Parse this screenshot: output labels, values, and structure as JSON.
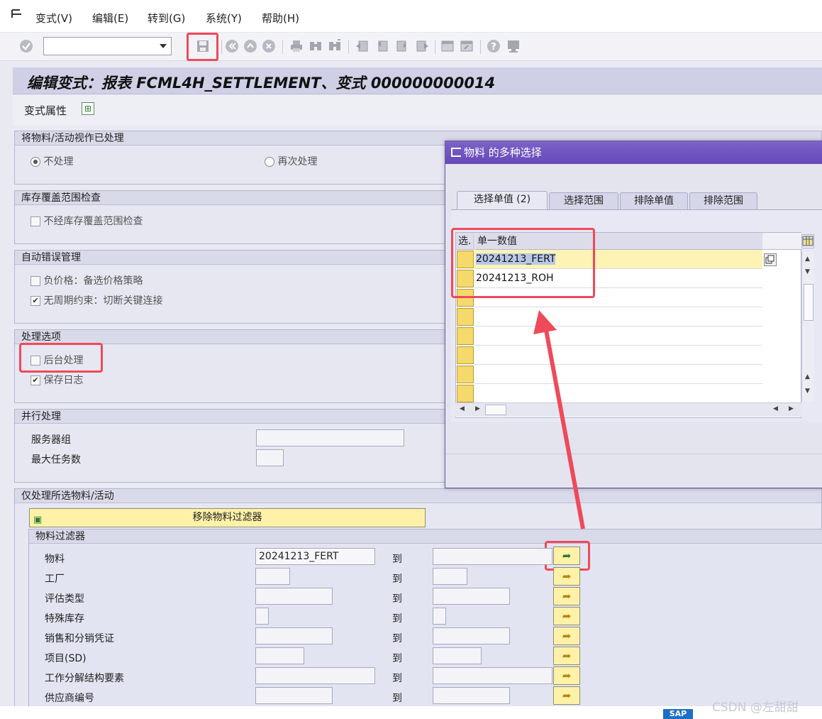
{
  "menu": {
    "items": [
      "变式(V)",
      "编辑(E)",
      "转到(G)",
      "系统(Y)",
      "帮助(H)"
    ]
  },
  "toolbar": {
    "command_value": "",
    "icons": [
      "enter-icon",
      "save-icon",
      "back-icon",
      "exit-icon",
      "cancel-icon",
      "print-icon",
      "find-icon",
      "find-next-icon",
      "first-page-icon",
      "prev-page-icon",
      "next-page-icon",
      "last-page-icon",
      "new-session-icon",
      "shortcut-icon",
      "help-icon",
      "customize-icon"
    ]
  },
  "page": {
    "title": "编辑变式：报表 FCML4H_SETTLEMENT、变式 000000000014",
    "app_button": "变式属性"
  },
  "groups": {
    "g1": {
      "title": "将物料/活动视作已处理",
      "opt1": "不处理",
      "opt2": "再次处理",
      "selected": "不处理"
    },
    "g2": {
      "title": "库存覆盖范围检查",
      "chk1": "不经库存覆盖范围检查",
      "chk1_checked": false
    },
    "g3": {
      "title": "自动错误管理",
      "chk1": "负价格：备选价格策略",
      "chk1_checked": false,
      "chk2": "无周期约束：切断关键连接",
      "chk2_checked": true
    },
    "g4": {
      "title": "处理选项",
      "chk1": "后台处理",
      "chk1_checked": false,
      "chk2": "保存日志",
      "chk2_checked": true
    },
    "g5": {
      "title": "并行处理",
      "l1": "服务器组",
      "l2": "最大任务数"
    },
    "g6": {
      "title": "仅处理所选物料/活动",
      "remove_btn": "移除物料过滤器",
      "sub_title": "物料过滤器",
      "to": "到",
      "rows": [
        {
          "label": "物料",
          "from": "20241213_FERT",
          "to_val": ""
        },
        {
          "label": "工厂",
          "from": "",
          "to_val": ""
        },
        {
          "label": "评估类型",
          "from": "",
          "to_val": ""
        },
        {
          "label": "特殊库存",
          "from": "",
          "to_val": ""
        },
        {
          "label": "销售和分销凭证",
          "from": "",
          "to_val": ""
        },
        {
          "label": "项目(SD)",
          "from": "",
          "to_val": ""
        },
        {
          "label": "工作分解结构要素",
          "from": "",
          "to_val": ""
        },
        {
          "label": "供应商编号",
          "from": "",
          "to_val": ""
        }
      ]
    }
  },
  "dialog": {
    "title": "物料 的多种选择",
    "tabs": [
      "选择单值 (2)",
      "选择范围",
      "排除单值",
      "排除范围"
    ],
    "active_tab": "选择单值 (2)",
    "col_sel": "选.",
    "col_value": "单一数值",
    "values": [
      "20241213_FERT",
      "20241213_ROH",
      "",
      "",
      "",
      "",
      "",
      ""
    ]
  },
  "footer": {
    "watermark": "CSDN @左甜甜",
    "logo": "SAP"
  },
  "colors": {
    "annotation": "#ee4a5a",
    "dialog_title": "#6a4cbc",
    "button_yellow": "#fff2a8"
  }
}
